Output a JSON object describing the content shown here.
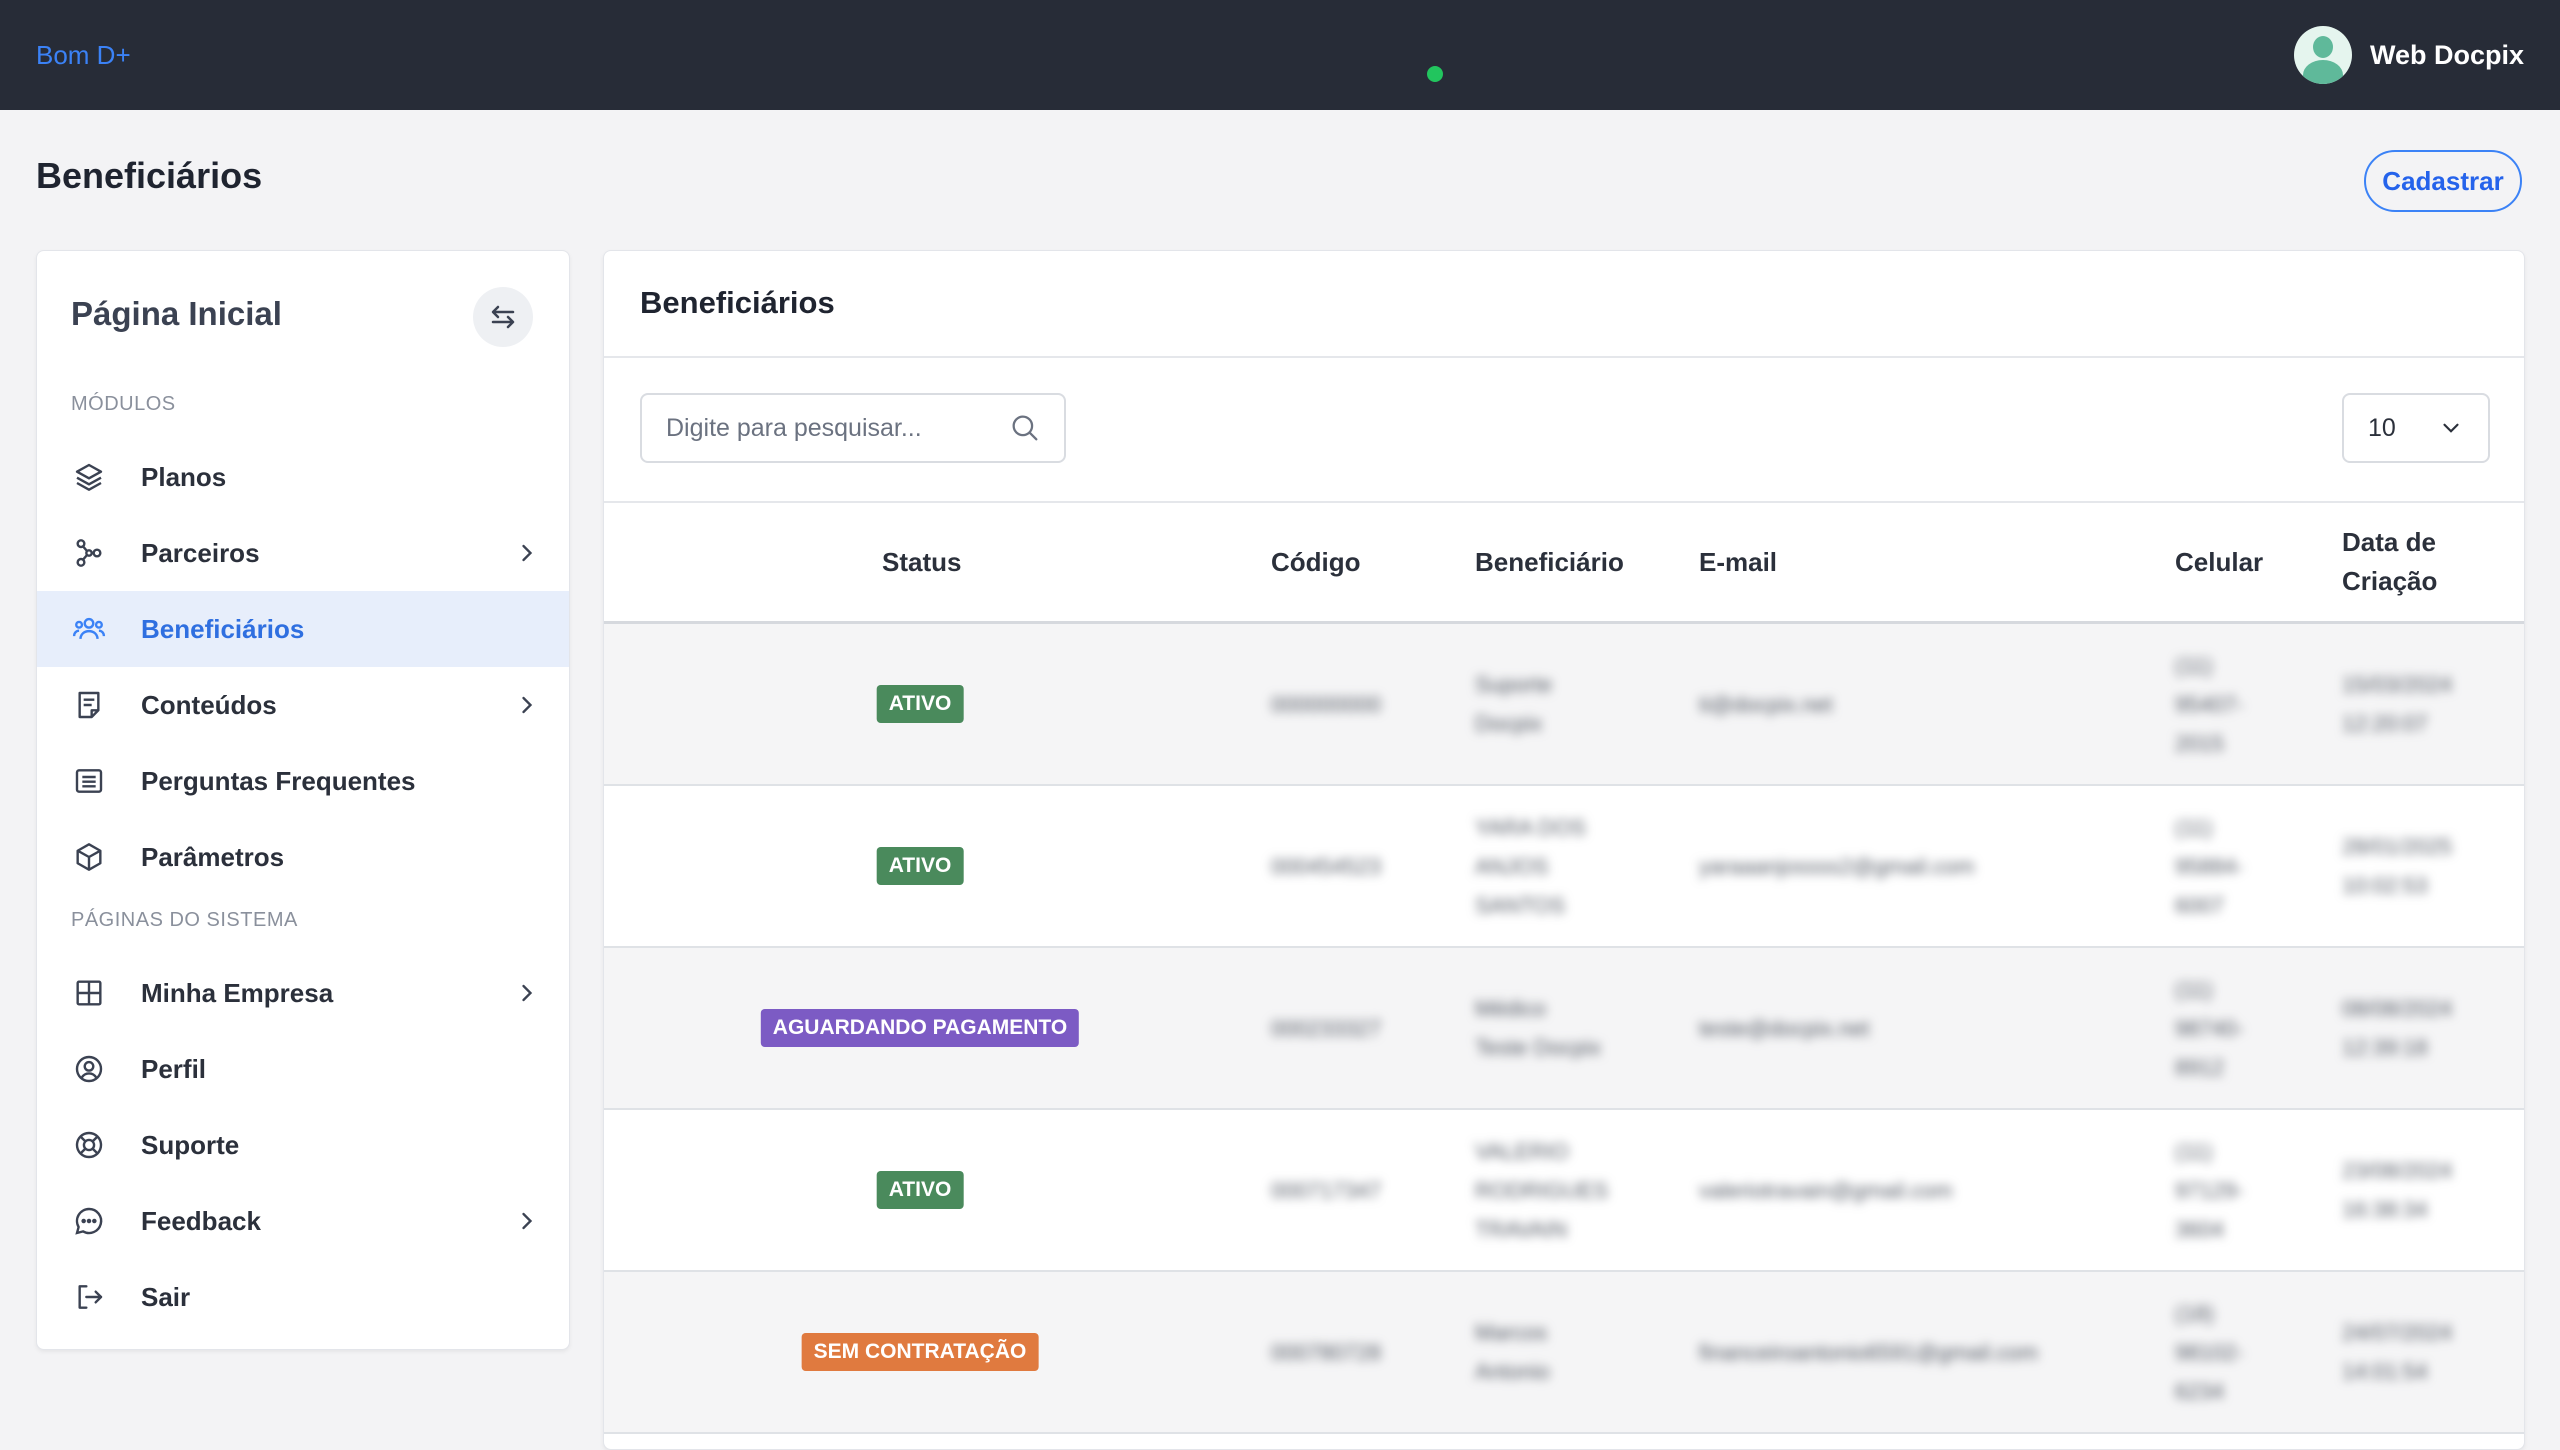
{
  "topbar": {
    "brand": "Bom D+",
    "user_name": "Web Docpix"
  },
  "page": {
    "title": "Beneficiários",
    "register_label": "Cadastrar"
  },
  "sidebar": {
    "title": "Página Inicial",
    "sections": [
      "MÓDULOS",
      "PÁGINAS DO SISTEMA"
    ],
    "items": [
      {
        "label": "Planos",
        "icon": "layers-icon",
        "chevron": false,
        "active": false
      },
      {
        "label": "Parceiros",
        "icon": "network-icon",
        "chevron": true,
        "active": false
      },
      {
        "label": "Beneficiários",
        "icon": "users-icon",
        "chevron": false,
        "active": true
      },
      {
        "label": "Conteúdos",
        "icon": "document-icon",
        "chevron": true,
        "active": false
      },
      {
        "label": "Perguntas Frequentes",
        "icon": "list-icon",
        "chevron": false,
        "active": false
      },
      {
        "label": "Parâmetros",
        "icon": "cube-icon",
        "chevron": false,
        "active": false
      },
      {
        "label": "Minha Empresa",
        "icon": "grid-icon",
        "chevron": true,
        "active": false
      },
      {
        "label": "Perfil",
        "icon": "user-circle-icon",
        "chevron": false,
        "active": false
      },
      {
        "label": "Suporte",
        "icon": "lifebuoy-icon",
        "chevron": false,
        "active": false
      },
      {
        "label": "Feedback",
        "icon": "chat-icon",
        "chevron": true,
        "active": false
      },
      {
        "label": "Sair",
        "icon": "logout-icon",
        "chevron": false,
        "active": false
      }
    ]
  },
  "main": {
    "card_title": "Beneficiários",
    "search_placeholder": "Digite para pesquisar...",
    "page_size": "10",
    "columns": {
      "status": "Status",
      "code": "Código",
      "beneficiary": "Beneficiário",
      "email": "E-mail",
      "phone": "Celular",
      "created": "Data de\nCriação"
    },
    "rows": [
      {
        "status": "ATIVO",
        "status_color": "#4a8a5c",
        "code": "000000000",
        "name": "Suporte\nDocpix",
        "email": "ti@docpix.net",
        "phone": "(11)\n95407-\n2015",
        "created": "15/03/2024\n12:20:07"
      },
      {
        "status": "ATIVO",
        "status_color": "#4a8a5c",
        "code": "000454523",
        "name": "YARA DOS\nANJOS\nSANTOS",
        "email": "yaraaanjossss2@gmail.com",
        "phone": "(11)\n95884-\n6007",
        "created": "28/01/2025\n10:02:53"
      },
      {
        "status": "AGUARDANDO PAGAMENTO",
        "status_color": "#7c5bc4",
        "code": "000233327",
        "name": "Médico\nTeste Docpix",
        "email": "teste@docpix.net",
        "phone": "(11)\n98740-\n8912",
        "created": "08/08/2024\n12:39:18"
      },
      {
        "status": "ATIVO",
        "status_color": "#4a8a5c",
        "code": "000717347",
        "name": "VALERIO\nRODRIGUES\nTRAVAIN",
        "email": "valeriotravain@gmail.com",
        "phone": "(11)\n97129-\n3604",
        "created": "23/08/2024\n16:38:34"
      },
      {
        "status": "SEM CONTRATAÇÃO",
        "status_color": "#e07a3f",
        "code": "000780728",
        "name": "Marcos\nAntonio",
        "email": "financeiroantonio6591@gmail.com",
        "phone": "(18)\n98102-\n6234",
        "created": "24/07/2024\n14:01:54"
      }
    ]
  }
}
